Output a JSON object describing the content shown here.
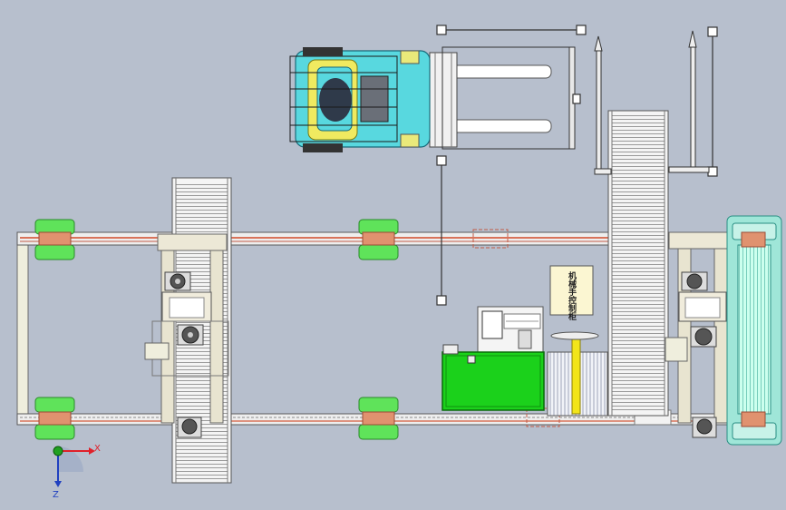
{
  "colors": {
    "background": "#b7bfcd",
    "frame": "#e8e4d0",
    "rail": "#d9735a",
    "conveyor": "#f2f2f2",
    "roller": "#b9b9b9",
    "pad_green": "#5fe35a",
    "cyan_conveyor": "#9fe6d8",
    "green_cabinet": "#1bd11b",
    "yellow_post": "#f2e51a",
    "forklift_cyan": "#58d8df",
    "forklift_yellow": "#f0ea60",
    "axis_x": "#e0202a",
    "axis_y": "#20a020",
    "axis_z": "#2040c0"
  },
  "sign": {
    "text": "机械手控制柜"
  },
  "axis": {
    "x_label": "X",
    "z_label": "Z"
  },
  "icons": {
    "axis_triad": "coordinate-triad-icon"
  }
}
